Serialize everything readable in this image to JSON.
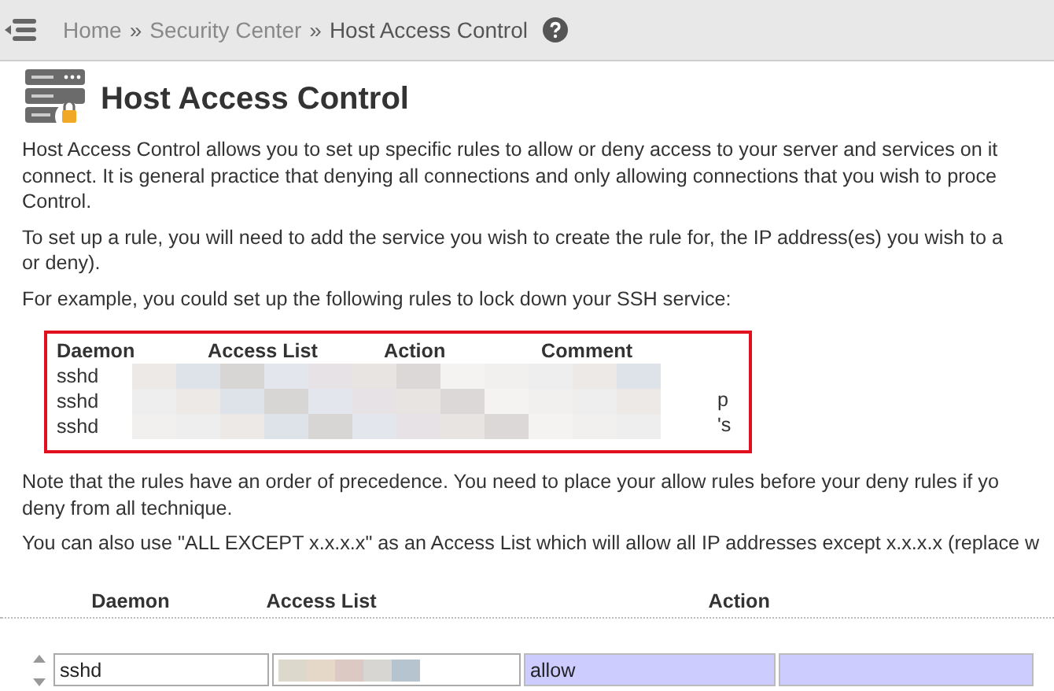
{
  "breadcrumb": {
    "items": [
      "Home",
      "Security Center",
      "Host Access Control"
    ],
    "separator": "»"
  },
  "title": "Host Access Control",
  "intro_lines": [
    "Host Access Control allows you to set up specific rules to allow or deny access to your server and services on it",
    "connect. It is general practice that denying all connections and only allowing connections that you wish to proce",
    "Control."
  ],
  "rule_lines": [
    "To set up a rule, you will need to add the service you wish to create the rule for, the IP address(es) you wish to a",
    "or deny)."
  ],
  "example_intro": "For example, you could set up the following rules to lock down your SSH service:",
  "example": {
    "columns": [
      "Daemon",
      "Access List",
      "Action",
      "Comment"
    ],
    "rows": [
      {
        "daemon": "sshd"
      },
      {
        "daemon": "sshd",
        "tail": "p"
      },
      {
        "daemon": "sshd",
        "tail": "'s"
      }
    ]
  },
  "note_lines": [
    "Note that the rules have an order of precedence. You need to place your allow rules before your deny rules if yo",
    "deny from all technique."
  ],
  "except_line": "You can also use \"ALL EXCEPT x.x.x.x\" as an Access List which will allow all IP addresses except x.x.x.x (replace w",
  "table": {
    "columns": [
      "Daemon",
      "Access List",
      "Action"
    ],
    "rows": [
      {
        "daemon": "sshd",
        "action": "allow"
      }
    ]
  }
}
